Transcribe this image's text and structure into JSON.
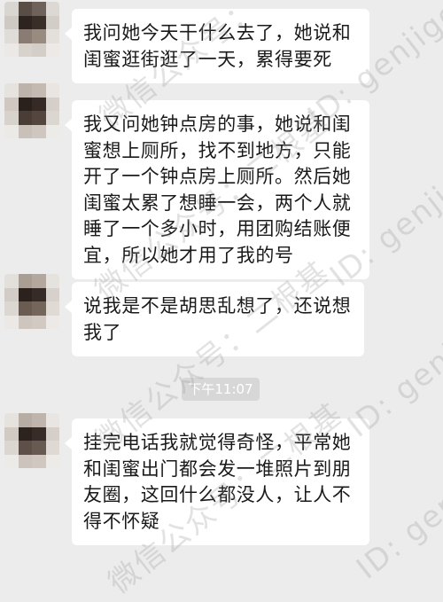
{
  "messages": [
    {
      "lines": [
        "我问她今天干什么去了，她说和",
        "闺蜜逛街逛了一天，累得要死"
      ]
    },
    {
      "lines": [
        "我又问她钟点房的事，她说和闺",
        "蜜想上厕所，找不到地方，只能",
        "开了一个钟点房上厕所。然后她",
        "闺蜜太累了想睡一会，两个人就",
        "睡了一个多小时，用团购结账便",
        "宜，所以她才用了我的号"
      ]
    },
    {
      "lines": [
        "说我是不是胡思乱想了，还说想",
        "我了"
      ]
    },
    {
      "lines": [
        "挂完电话我就觉得奇怪，平常她",
        "和闺蜜出门都会发一堆照片到朋",
        "友圈，这回什么都没人，让人不",
        "得不怀疑"
      ]
    }
  ],
  "timestamp": "下午11:07",
  "watermarks": [
    "微信公众号：",
    "ID: genjige",
    "微信公众号：二根基",
    "ID: genjige",
    "微信公众号：二根基",
    "ID: genjige",
    "微信公众号：二根基",
    "ID: genjige"
  ],
  "colors": {
    "background": "#ececec",
    "bubble": "#ffffff",
    "text": "#1a1a1a",
    "timestamp_bg": "#d7d7d7"
  }
}
